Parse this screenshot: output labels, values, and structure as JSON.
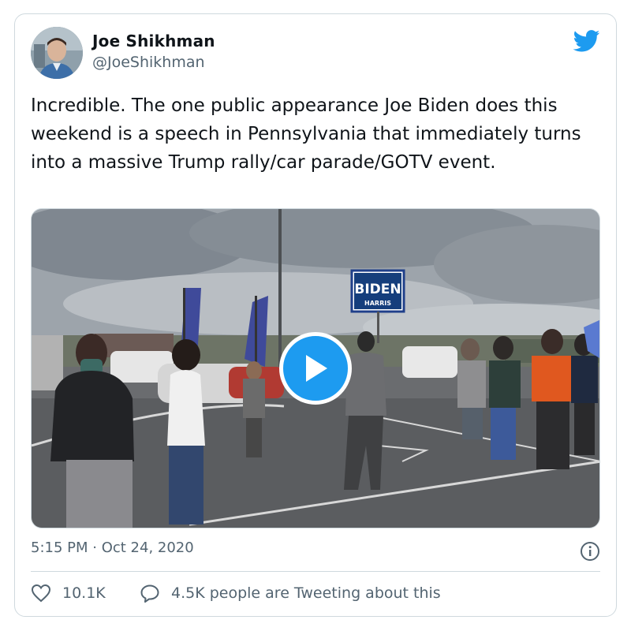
{
  "author": {
    "display_name": "Joe Shikhman",
    "handle": "@JoeShikhman"
  },
  "tweet": {
    "text": "Incredible. The one public appearance Joe Biden does this weekend is a speech in Pennsylvania that immediately turns into a massive Trump rally/car parade/GOTV event.",
    "timestamp": "5:15 PM · Oct 24, 2020"
  },
  "media": {
    "sign_text_main": "BIDEN",
    "sign_text_sub": "HARRIS"
  },
  "actions": {
    "like_count": "10.1K",
    "reply_text": "4.5K people are Tweeting about this"
  },
  "colors": {
    "brand_blue": "#1d9bf0",
    "text_primary": "#0f1419",
    "text_secondary": "#536471",
    "border": "#cfd9de"
  },
  "icons": [
    "twitter-bird-icon",
    "play-icon",
    "info-icon",
    "heart-icon",
    "speech-bubble-icon"
  ]
}
